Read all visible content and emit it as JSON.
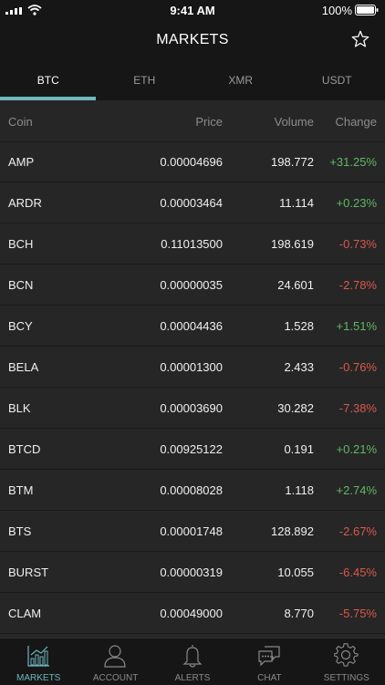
{
  "status": {
    "time": "9:41 AM",
    "battery": "100%"
  },
  "header": {
    "title": "MARKETS"
  },
  "tabs": [
    {
      "label": "BTC",
      "active": true
    },
    {
      "label": "ETH"
    },
    {
      "label": "XMR"
    },
    {
      "label": "USDT"
    }
  ],
  "columns": {
    "coin": "Coin",
    "price": "Price",
    "volume": "Volume",
    "change": "Change"
  },
  "rows": [
    {
      "coin": "AMP",
      "price": "0.00004696",
      "volume": "198.772",
      "change": "+31.25%",
      "dir": "pos"
    },
    {
      "coin": "ARDR",
      "price": "0.00003464",
      "volume": "11.114",
      "change": "+0.23%",
      "dir": "pos"
    },
    {
      "coin": "BCH",
      "price": "0.11013500",
      "volume": "198.619",
      "change": "-0.73%",
      "dir": "neg"
    },
    {
      "coin": "BCN",
      "price": "0.00000035",
      "volume": "24.601",
      "change": "-2.78%",
      "dir": "neg"
    },
    {
      "coin": "BCY",
      "price": "0.00004436",
      "volume": "1.528",
      "change": "+1.51%",
      "dir": "pos"
    },
    {
      "coin": "BELA",
      "price": "0.00001300",
      "volume": "2.433",
      "change": "-0.76%",
      "dir": "neg"
    },
    {
      "coin": "BLK",
      "price": "0.00003690",
      "volume": "30.282",
      "change": "-7.38%",
      "dir": "neg"
    },
    {
      "coin": "BTCD",
      "price": "0.00925122",
      "volume": "0.191",
      "change": "+0.21%",
      "dir": "pos"
    },
    {
      "coin": "BTM",
      "price": "0.00008028",
      "volume": "1.118",
      "change": "+2.74%",
      "dir": "pos"
    },
    {
      "coin": "BTS",
      "price": "0.00001748",
      "volume": "128.892",
      "change": "-2.67%",
      "dir": "neg"
    },
    {
      "coin": "BURST",
      "price": "0.00000319",
      "volume": "10.055",
      "change": "-6.45%",
      "dir": "neg"
    },
    {
      "coin": "CLAM",
      "price": "0.00049000",
      "volume": "8.770",
      "change": "-5.75%",
      "dir": "neg"
    }
  ],
  "tabbar": [
    {
      "label": "MARKETS",
      "icon": "chart-icon",
      "active": true
    },
    {
      "label": "ACCOUNT",
      "icon": "person-icon"
    },
    {
      "label": "ALERTS",
      "icon": "bell-icon"
    },
    {
      "label": "CHAT",
      "icon": "chat-icon"
    },
    {
      "label": "SETTINGS",
      "icon": "gear-icon"
    }
  ],
  "colors": {
    "accent": "#6fb6bd",
    "positive": "#5fb865",
    "negative": "#d9594c"
  }
}
